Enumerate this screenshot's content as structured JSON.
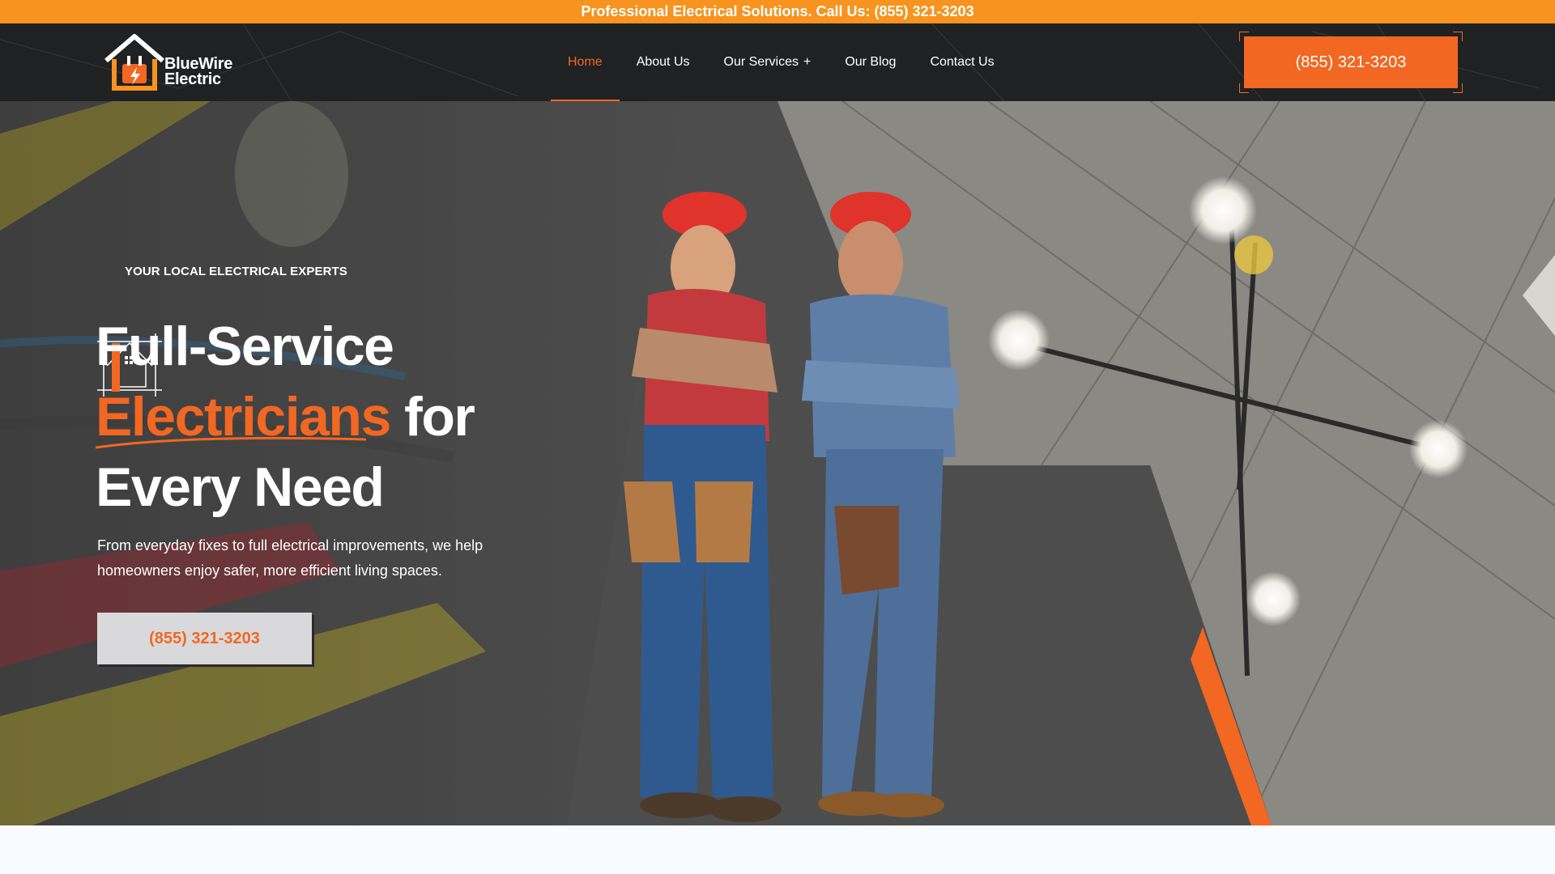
{
  "topbar": {
    "text": "Professional Electrical Solutions. Call Us: (855) 321-3203"
  },
  "brand": {
    "line1": "BlueWire",
    "line2": "Electric",
    "accent": "#f26722",
    "topbar_color": "#f7931e"
  },
  "nav": {
    "items": [
      {
        "label": "Home",
        "active": true
      },
      {
        "label": "About Us"
      },
      {
        "label": "Our Services",
        "has_submenu": true,
        "submenu_glyph": "+"
      },
      {
        "label": "Our Blog"
      },
      {
        "label": "Contact Us"
      }
    ]
  },
  "header": {
    "cta_label": "(855) 321-3203"
  },
  "hero": {
    "eyebrow": "YOUR LOCAL ELECTRICAL EXPERTS",
    "headline_line1": "Full-Service",
    "headline_accent": "Electricians",
    "headline_line2_rest": " for",
    "headline_line3": "Every Need",
    "subtext": "From everyday fixes to full electrical improvements, we help homeowners enjoy safer, more efficient living spaces.",
    "cta_label": "(855) 321-3203"
  },
  "icons": [
    "house-plug-logo-icon",
    "house-blueprint-badge-icon",
    "plus-icon"
  ]
}
